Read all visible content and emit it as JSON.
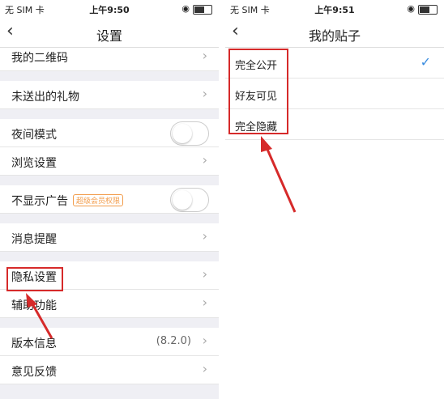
{
  "left": {
    "status": {
      "carrier": "无 SIM 卡",
      "time": "上午9:50"
    },
    "title": "设置",
    "rows": [
      {
        "label": "我的二维码"
      },
      {
        "label": "未送出的礼物"
      },
      {
        "label": "夜间模式"
      },
      {
        "label": "浏览设置"
      },
      {
        "label": "不显示广告",
        "badge": "超级会员权限"
      },
      {
        "label": "消息提醒"
      },
      {
        "label": "隐私设置"
      },
      {
        "label": "辅助功能"
      },
      {
        "label": "版本信息",
        "value": "(8.2.0)"
      },
      {
        "label": "意见反馈"
      }
    ]
  },
  "right": {
    "status": {
      "carrier": "无 SIM 卡",
      "time": "上午9:51"
    },
    "title": "我的贴子",
    "options": [
      "完全公开",
      "好友可见",
      "完全隐藏"
    ]
  },
  "colors": {
    "accent_red": "#d62a2a",
    "check_blue": "#3b8de0",
    "badge_orange": "#f29c4b"
  }
}
